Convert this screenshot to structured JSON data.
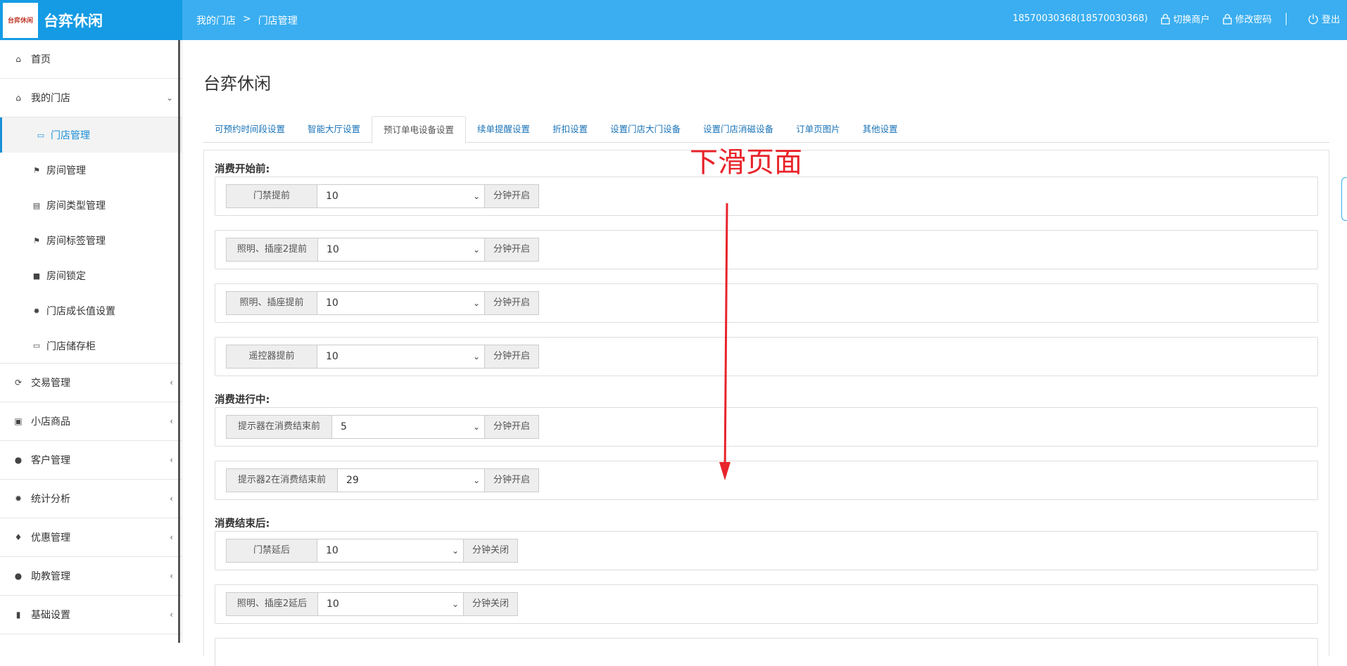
{
  "header": {
    "brand_name": "台弈休闲",
    "logo_text": "台弈休闲",
    "breadcrumb": [
      "我的门店",
      ">",
      "门店管理"
    ],
    "account": "18570030368(18570030368)",
    "switch_merchant": "切换商户",
    "change_password": "修改密码",
    "logout": "登出"
  },
  "sidebar": {
    "items": [
      {
        "label": "首页",
        "icon": "home-icon"
      },
      {
        "label": "我的门店",
        "icon": "home-icon",
        "expanded": true
      },
      {
        "label": "交易管理",
        "icon": "refresh-icon"
      },
      {
        "label": "小店商品",
        "icon": "gift-icon"
      },
      {
        "label": "客户管理",
        "icon": "user-icon"
      },
      {
        "label": "统计分析",
        "icon": "gear-icon"
      },
      {
        "label": "优惠管理",
        "icon": "tags-icon"
      },
      {
        "label": "助教管理",
        "icon": "user-icon"
      },
      {
        "label": "基础设置",
        "icon": "barcode-icon"
      }
    ],
    "subitems": [
      {
        "label": "门店管理",
        "icon": "inbox-icon",
        "active": true
      },
      {
        "label": "房间管理",
        "icon": "flag-icon"
      },
      {
        "label": "房间类型管理",
        "icon": "list-icon"
      },
      {
        "label": "房间标签管理",
        "icon": "bookmark-icon"
      },
      {
        "label": "房间锁定",
        "icon": "lock-icon"
      },
      {
        "label": "门店成长值设置",
        "icon": "cog-icon"
      },
      {
        "label": "门店储存柜",
        "icon": "inbox-icon"
      }
    ]
  },
  "main": {
    "title": "台弈休闲",
    "tabs": [
      "可预约时间段设置",
      "智能大厅设置",
      "预订单电设备设置",
      "续单提醒设置",
      "折扣设置",
      "设置门店大门设备",
      "设置门店消磁设备",
      "订单页图片",
      "其他设置"
    ],
    "active_tab": 2,
    "sections": [
      {
        "title": "消费开始前:",
        "rows": [
          {
            "label": "门禁提前",
            "value": "10",
            "suffix": "分钟开启"
          },
          {
            "label": "照明、插座2提前",
            "value": "10",
            "suffix": "分钟开启"
          },
          {
            "label": "照明、插座提前",
            "value": "10",
            "suffix": "分钟开启"
          },
          {
            "label": "遥控器提前",
            "value": "10",
            "suffix": "分钟开启"
          }
        ]
      },
      {
        "title": "消费进行中:",
        "rows": [
          {
            "label": "提示器在消费结束前",
            "value": "5",
            "suffix": "分钟开启"
          },
          {
            "label": "提示器2在消费结束前",
            "value": "29",
            "suffix": "分钟开启"
          }
        ]
      },
      {
        "title": "消费结束后:",
        "rows": [
          {
            "label": "门禁延后",
            "value": "10",
            "suffix": "分钟关闭"
          },
          {
            "label": "照明、插座2延后",
            "value": "10",
            "suffix": "分钟关闭"
          }
        ]
      }
    ]
  },
  "annotation": {
    "text": "下滑页面",
    "color": "#e8232a"
  },
  "colors": {
    "topbar": "#3aaef0",
    "brand": "#149be4",
    "link": "#1a73b8",
    "active": "#1a8fd8"
  }
}
